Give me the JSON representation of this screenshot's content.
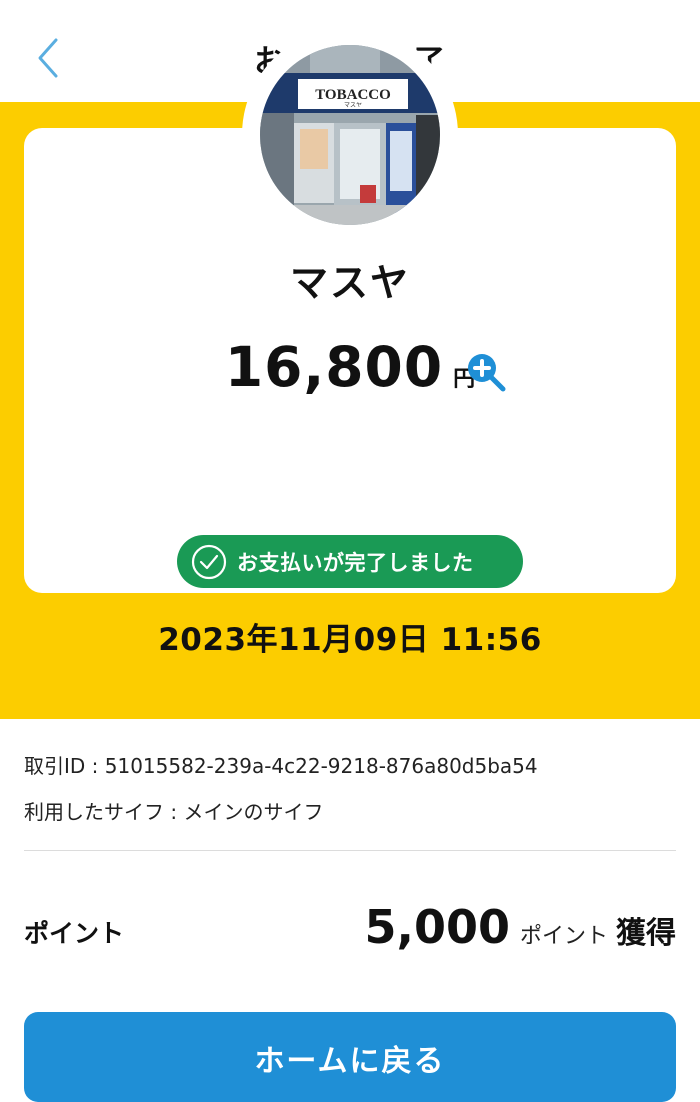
{
  "header": {
    "title": "お支払い完了",
    "back_icon": "chevron-left-icon"
  },
  "merchant": {
    "name": "マスヤ",
    "photo_sign_text": "TOBACCO",
    "photo_sign_sub": "マスヤ"
  },
  "payment": {
    "amount": "16,800",
    "currency": "円",
    "status": "お支払いが完了しました",
    "datetime": "2023年11月09日 11:56"
  },
  "details": {
    "transaction_id": "取引ID : 51015582-239a-4c22-9218-876a80d5ba54",
    "wallet": "利用したサイフ :  メインのサイフ"
  },
  "points": {
    "label": "ポイント",
    "value": "5,000",
    "unit": "ポイント",
    "earned": "獲得"
  },
  "actions": {
    "home_label": "ホームに戻る"
  },
  "colors": {
    "hero_yellow": "#fccd00",
    "success_green": "#1a9a55",
    "primary_blue": "#1f8fd6",
    "back_arrow": "#5aaee0"
  }
}
